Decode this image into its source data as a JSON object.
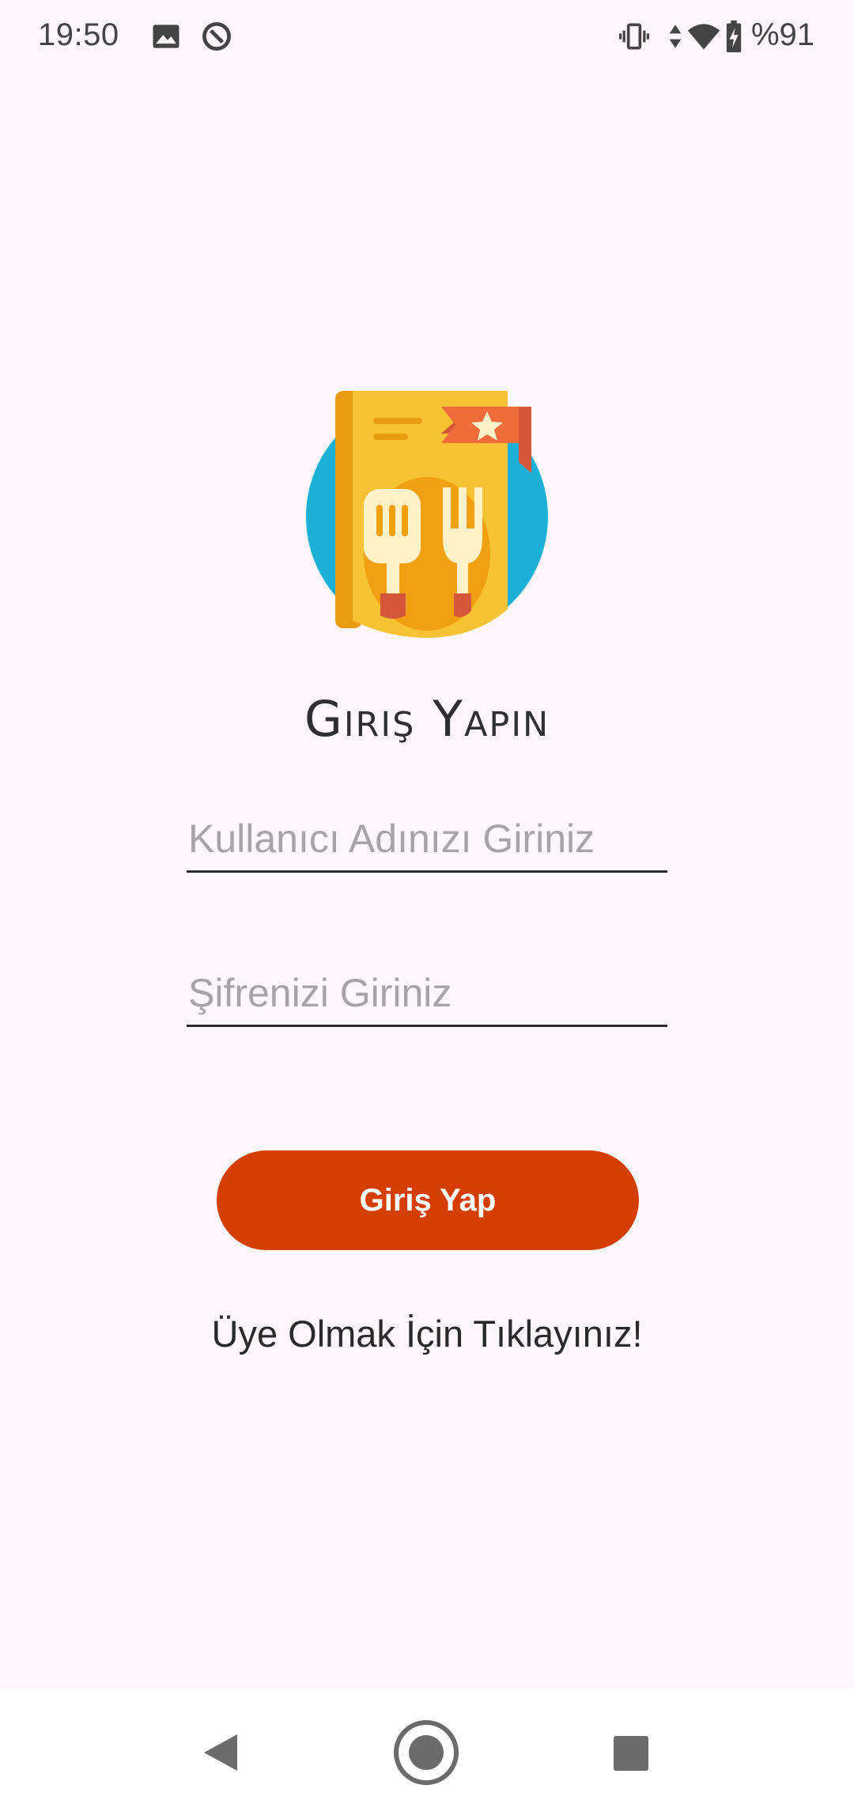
{
  "status_bar": {
    "time": "19:50",
    "battery": "%91",
    "icons": [
      "image-icon",
      "data-saver-icon",
      "vibrate-icon",
      "data-arrows-icon",
      "wifi-icon",
      "battery-charging-icon"
    ]
  },
  "logo": {
    "icon": "recipe-book-icon",
    "colors": {
      "circle": "#1cb0d6",
      "book": "#f7c233",
      "spine": "#e99b12",
      "ribbon": "#f06c3a",
      "plate": "#f0a010",
      "utensils": "#fff1c8"
    }
  },
  "login": {
    "title": "Giriş Yapın",
    "username_placeholder": "Kullanıcı Adınızı Giriniz",
    "password_placeholder": "Şifrenizi Giriniz",
    "button_label": "Giriş Yap",
    "register_text": "Üye Olmak İçin Tıklayınız!"
  },
  "colors": {
    "background": "#fdf7fc",
    "button": "#d43f00",
    "button_text": "#ffffff"
  },
  "nav_bar": {
    "icons": [
      "back-icon",
      "home-icon",
      "recents-icon"
    ]
  }
}
